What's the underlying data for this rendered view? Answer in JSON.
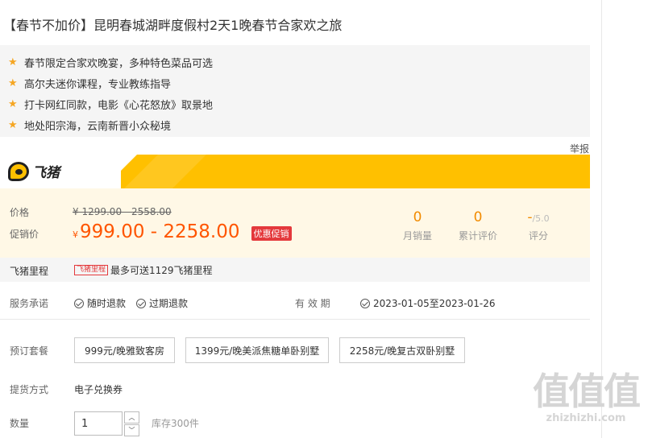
{
  "title": "【春节不加价】昆明春城湖畔度假村2天1晚春节合家欢之旅",
  "highlights": [
    "春节限定合家欢晚宴，多种特色菜品可选",
    "高尔夫迷你课程，专业教练指导",
    "打卡网红同款，电影《心花怒放》取景地",
    "地处阳宗海，云南新晋小众秘境"
  ],
  "report_label": "举报",
  "brand": {
    "logo_text": "飞猪",
    "logo_icon": "pig-icon",
    "bar_color": "#ffc000"
  },
  "price": {
    "label": "价格",
    "original": "¥ 1299.00 - 2558.00",
    "sale_label": "促销价",
    "sale_currency": "¥",
    "sale_amount": "999.00 - 2258.00",
    "promo_badge": "优惠促销"
  },
  "stats": [
    {
      "value": "0",
      "label": "月销量"
    },
    {
      "value": "0",
      "label": "累计评价"
    },
    {
      "value": "-",
      "suffix": "/5.0",
      "label": "评分"
    }
  ],
  "miles": {
    "label": "飞猪里程",
    "badge": "飞猪里程",
    "text": "最多可送1129飞猪里程"
  },
  "service": {
    "label": "服务承诺",
    "items": [
      "随时退款",
      "过期退款"
    ],
    "validity_label": "有 效 期",
    "validity_value": "2023-01-05至2023-01-26"
  },
  "packages": {
    "label": "预订套餐",
    "options": [
      "999元/晚雅致客房",
      "1399元/晚美派焦糖单卧别墅",
      "2258元/晚复古双卧别墅"
    ]
  },
  "delivery": {
    "label": "提货方式",
    "value": "电子兑换券"
  },
  "quantity": {
    "label": "数量",
    "value": "1",
    "stock": "库存300件"
  },
  "watermark": {
    "main": "值值值",
    "sub": "zhizhizhi.com"
  },
  "colors": {
    "accent": "#ff5500",
    "stat": "#f28b00",
    "badge": "#e4393c",
    "star": "#f5a623"
  }
}
